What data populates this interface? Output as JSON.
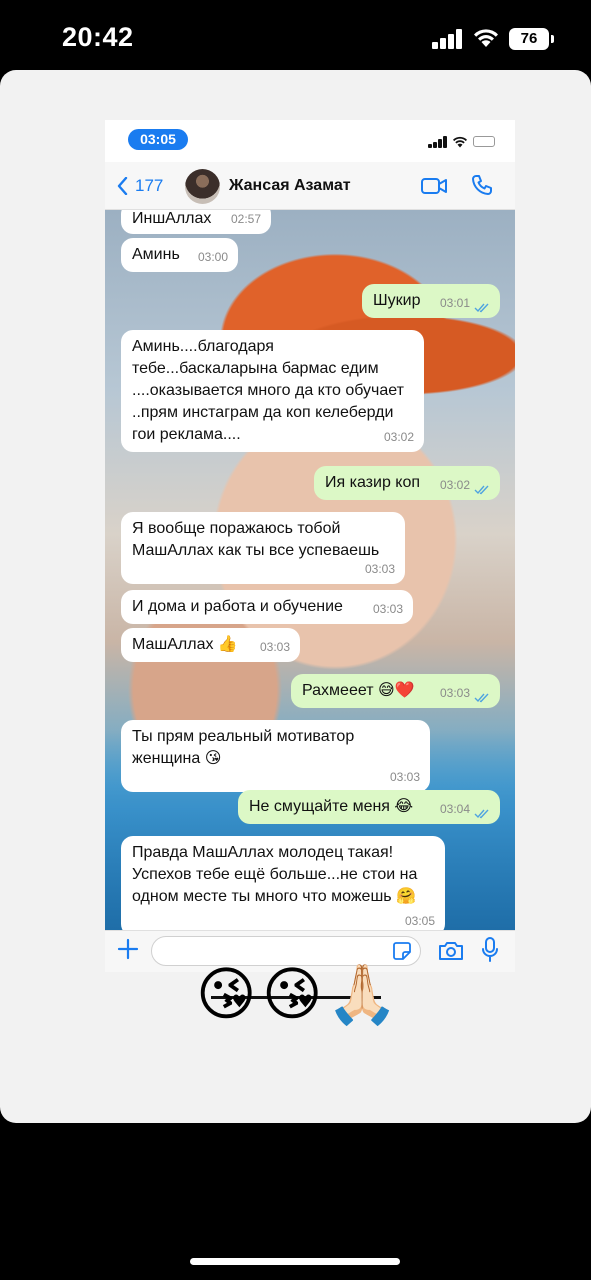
{
  "outer_status": {
    "time": "20:42",
    "battery": "76"
  },
  "inner_status": {
    "time": "03:05"
  },
  "chat_header": {
    "back_count": "177",
    "contact_name": "Жансая Азамат"
  },
  "messages": [
    {
      "text": "ИншАллах",
      "time": "02:57",
      "direction": "in"
    },
    {
      "text": "Аминь",
      "time": "03:00",
      "direction": "in"
    },
    {
      "text": "Шукир",
      "time": "03:01",
      "direction": "out"
    },
    {
      "text": "Аминь....благодаря тебе...баскаларына бармас едим ....оказывается много да кто обучает ..прям инстаграм да коп келеберди гои реклама....",
      "time": "03:02",
      "direction": "in"
    },
    {
      "text": "Ия казир коп",
      "time": "03:02",
      "direction": "out"
    },
    {
      "text": "Я вообще поражаюсь тобой МашАллах как ты все успеваешь",
      "time": "03:03",
      "direction": "in"
    },
    {
      "text": "И дома и работа и обучение",
      "time": "03:03",
      "direction": "in"
    },
    {
      "text": "МашАллах 👍",
      "time": "03:03",
      "direction": "in"
    },
    {
      "text": "Рахмееет 😅❤️",
      "time": "03:03",
      "direction": "out"
    },
    {
      "text": "Ты прям реальный мотиватор женщина 😘",
      "time": "03:03",
      "direction": "in"
    },
    {
      "text": "Не смущайте меня 😂",
      "time": "03:04",
      "direction": "out"
    },
    {
      "text": "Правда МашАллах молодец такая! Успехов тебе ещё больше...не стои на одном месте ты много что можешь 🤗",
      "time": "03:05",
      "direction": "in"
    }
  ],
  "input": {
    "placeholder": ""
  },
  "emojis": [
    "😘",
    "😘",
    "🙏🏻"
  ],
  "colors": {
    "accent": "#1a7cf0",
    "outgoing_bubble": "#dcf8c6",
    "incoming_bubble": "#ffffff"
  }
}
